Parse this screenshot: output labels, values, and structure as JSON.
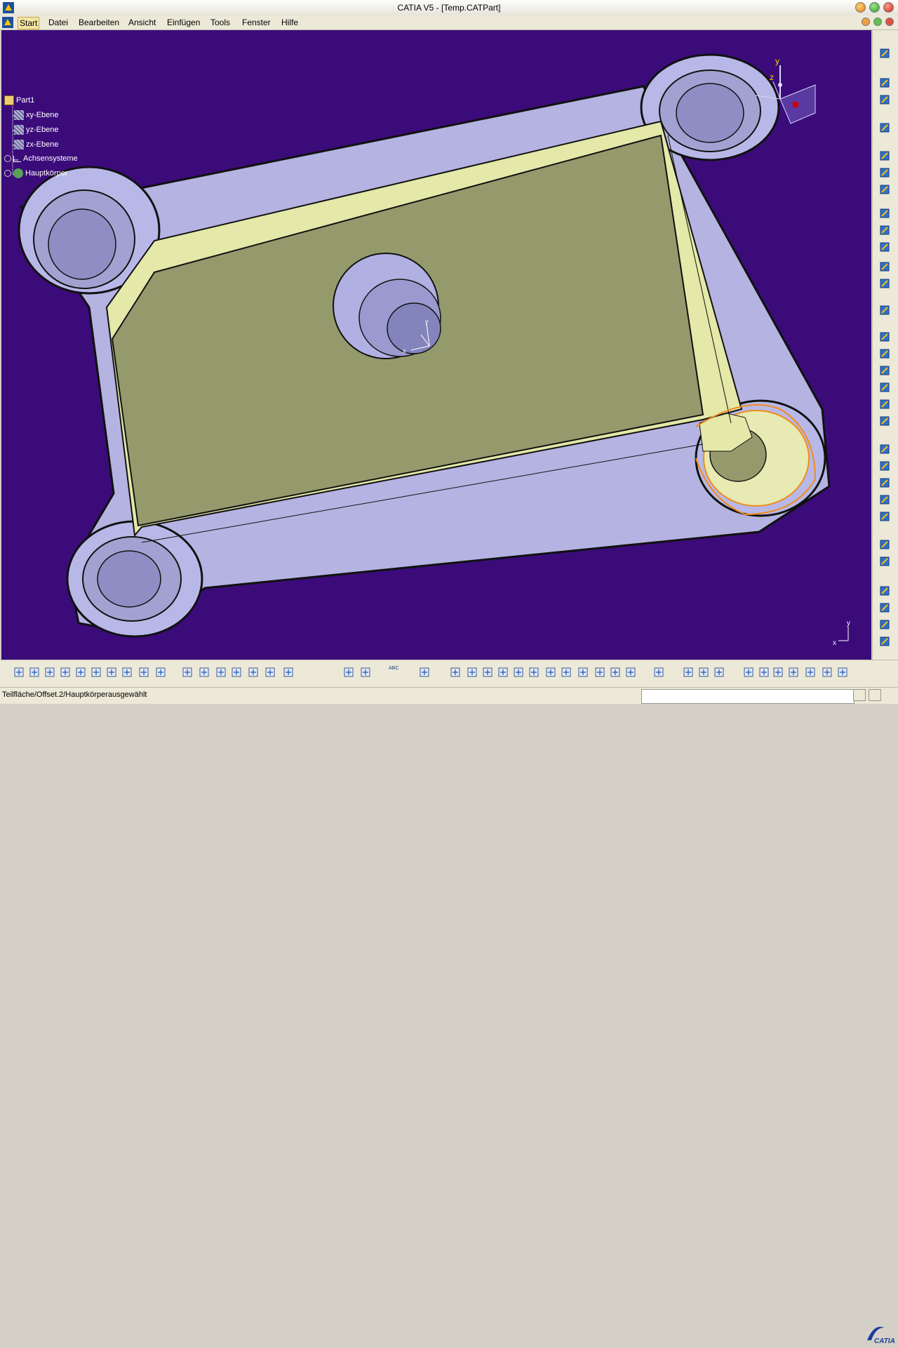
{
  "window": {
    "title": "CATIA V5 - [Temp.CATPart]"
  },
  "menu": {
    "items": [
      "Start",
      "Datei",
      "Bearbeiten",
      "Ansicht",
      "Einfügen",
      "Tools",
      "Fenster",
      "Hilfe"
    ]
  },
  "tree": {
    "root": "Part1",
    "nodes": [
      {
        "label": "xy-Ebene"
      },
      {
        "label": "yz-Ebene"
      },
      {
        "label": "zx-Ebene"
      },
      {
        "label": "Achsensysteme"
      },
      {
        "label": "Hauptkörper"
      }
    ]
  },
  "compass": {
    "y": "y",
    "z": "z"
  },
  "triad": {
    "x": "x",
    "y": "y"
  },
  "axis_small": {
    "x": "x",
    "y": "y"
  },
  "status": {
    "text": "Teilfläche/Offset.2/Hauptkörperausgewählt",
    "input_value": ""
  },
  "toolbar_bottom": {
    "abc_label": "ABC"
  },
  "logo": {
    "text": "CATIA"
  },
  "colors": {
    "background": "#3b0b7a",
    "part_side": "#b8b8e6",
    "floor": "#959a6c",
    "wall_inner": "#e4e8a8",
    "selection": "#f08c1a"
  }
}
